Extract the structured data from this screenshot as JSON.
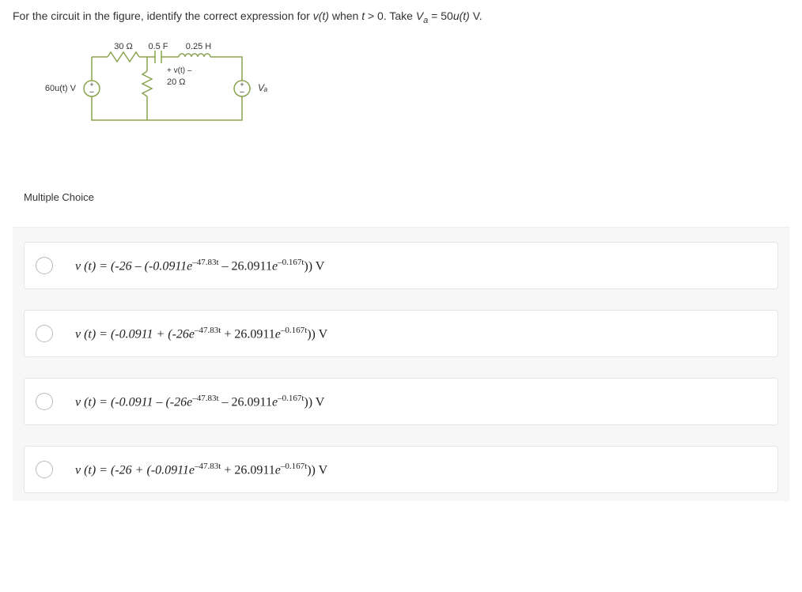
{
  "question": {
    "prefix": "For the circuit in the figure, identify the correct expression for ",
    "vt": "v(t)",
    "mid1": " when ",
    "t": "t",
    "gt0": " > 0. Take ",
    "va_sym": "V",
    "va_sub": "a",
    "eq": " = 50",
    "ut": "u(t)",
    "suffix": " V."
  },
  "circuit": {
    "r1": "30 Ω",
    "c": "0.5 F",
    "l": "0.25 H",
    "vt_label": "+ v(t) –",
    "r2": "20 Ω",
    "src_left": "60u(t) V",
    "src_right": "Vₐ"
  },
  "mc_label": "Multiple Choice",
  "options": [
    {
      "pre": "v (t) = (-26 – (-0.0911",
      "exp1": "e",
      "sup1": "–47.83t",
      "mid": " – 26.0911",
      "exp2": "e",
      "sup2": "–0.167t",
      "post": ")) V"
    },
    {
      "pre": "v (t) = (-0.0911 + (-26",
      "exp1": "e",
      "sup1": "–47.83t",
      "mid": " + 26.0911",
      "exp2": "e",
      "sup2": "–0.167t",
      "post": ")) V"
    },
    {
      "pre": "v (t) = (-0.0911 – (-26",
      "exp1": "e",
      "sup1": "–47.83t",
      "mid": " – 26.0911",
      "exp2": "e",
      "sup2": "–0.167t",
      "post": ")) V"
    },
    {
      "pre": "v (t) = (-26 + (-0.0911",
      "exp1": "e",
      "sup1": "–47.83t",
      "mid": " + 26.0911",
      "exp2": "e",
      "sup2": "–0.167t",
      "post": ")) V"
    }
  ]
}
